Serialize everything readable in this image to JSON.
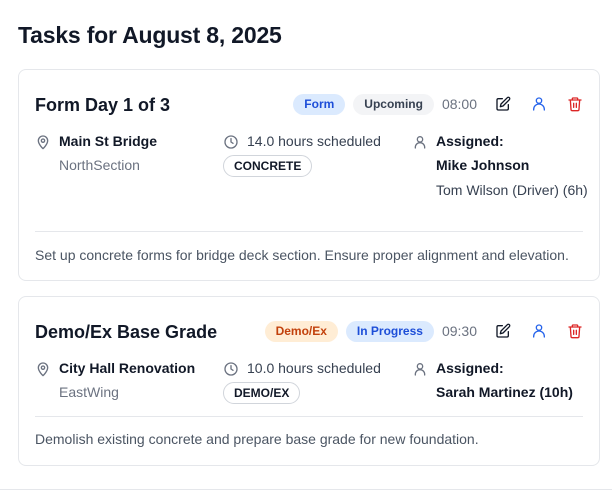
{
  "page": {
    "title": "Tasks for August 8, 2025"
  },
  "tasks": [
    {
      "title": "Form Day 1 of 3",
      "type_badge": "Form",
      "status_badge": "Upcoming",
      "time": "08:00",
      "location": "Main St Bridge",
      "section": "NorthSection",
      "hours": "14.0 hours scheduled",
      "category": "CONCRETE",
      "assigned_label": "Assigned:",
      "assigned_primary": "Mike Johnson",
      "assigned_secondary": "Tom Wilson (Driver) (6h)",
      "description": "Set up concrete forms for bridge deck section. Ensure proper alignment and elevation."
    },
    {
      "title": "Demo/Ex Base Grade",
      "type_badge": "Demo/Ex",
      "status_badge": "In Progress",
      "time": "09:30",
      "location": "City Hall Renovation",
      "section": "EastWing",
      "hours": "10.0 hours scheduled",
      "category": "DEMO/EX",
      "assigned_label": "Assigned:",
      "assigned_primary": "Sarah Martinez (10h)",
      "description": "Demolish existing concrete and prepare base grade for new foundation."
    }
  ],
  "icons": {
    "edit": "edit-icon",
    "assign": "user-icon",
    "delete": "trash-icon",
    "location": "map-pin-icon",
    "clock": "clock-icon",
    "person": "person-icon"
  },
  "colors": {
    "edit_icon": "#111827",
    "assign_icon": "#2563eb",
    "delete_icon": "#dc2626",
    "form_badge_bg": "#dbeafe",
    "demo_badge_bg": "#ffedd5"
  }
}
